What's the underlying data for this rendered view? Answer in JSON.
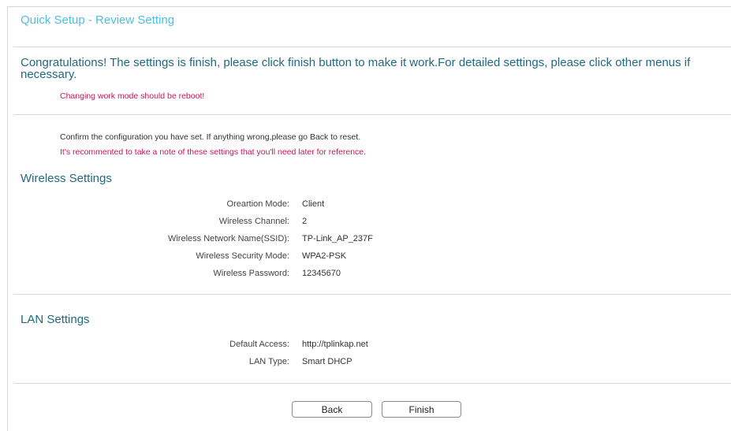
{
  "header": {
    "title": "Quick Setup - Review Setting"
  },
  "notice": {
    "congrats": "Congratulations! The settings is finish, please click finish button to make it work.For detailed settings, please click other menus if necessary.",
    "reboot_warning": "Changing work mode should be reboot!"
  },
  "intro": {
    "confirm_text": "Confirm the configuration you have set. If anything wrong,please go Back to reset.",
    "recommend_text": "It's recommented to take a note of these settings that you'll need later for reference."
  },
  "wireless": {
    "title": "Wireless Settings",
    "fields": [
      {
        "label": "Oreartion Mode:",
        "value": "Client"
      },
      {
        "label": "Wireless Channel:",
        "value": "2"
      },
      {
        "label": "Wireless Network Name(SSID):",
        "value": "TP-Link_AP_237F"
      },
      {
        "label": "Wireless Security Mode:",
        "value": "WPA2-PSK"
      },
      {
        "label": "Wireless Password:",
        "value": "12345670"
      }
    ]
  },
  "lan": {
    "title": "LAN Settings",
    "fields": [
      {
        "label": "Default Access:",
        "value": "http://tplinkap.net"
      },
      {
        "label": "LAN Type:",
        "value": "Smart DHCP"
      }
    ]
  },
  "buttons": {
    "back_label": "Back",
    "finish_label": "Finish"
  },
  "colors": {
    "title_accent": "#4fbde3",
    "heading": "#1f6a82",
    "warning": "#c2185b"
  }
}
